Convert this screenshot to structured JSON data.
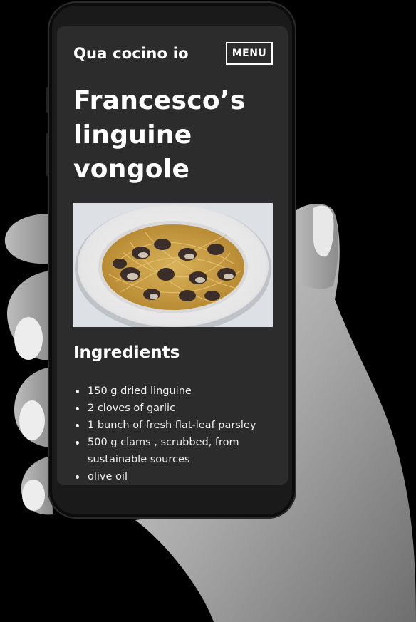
{
  "site": {
    "title": "Qua cocino io",
    "menu_label": "MENU"
  },
  "recipe": {
    "title": "Francesco’s linguine vongole",
    "image_alt": "Plate of linguine with clams",
    "ingredients_heading": "Ingredients",
    "ingredients": [
      "150 g dried linguine",
      "2 cloves of garlic",
      "1 bunch of fresh flat-leaf parsley",
      "500 g clams , scrubbed, from sustainable sources",
      "olive oil"
    ]
  },
  "colors": {
    "screen_bg": "#2c2c2c",
    "text": "#ffffff",
    "background": "#000000"
  }
}
